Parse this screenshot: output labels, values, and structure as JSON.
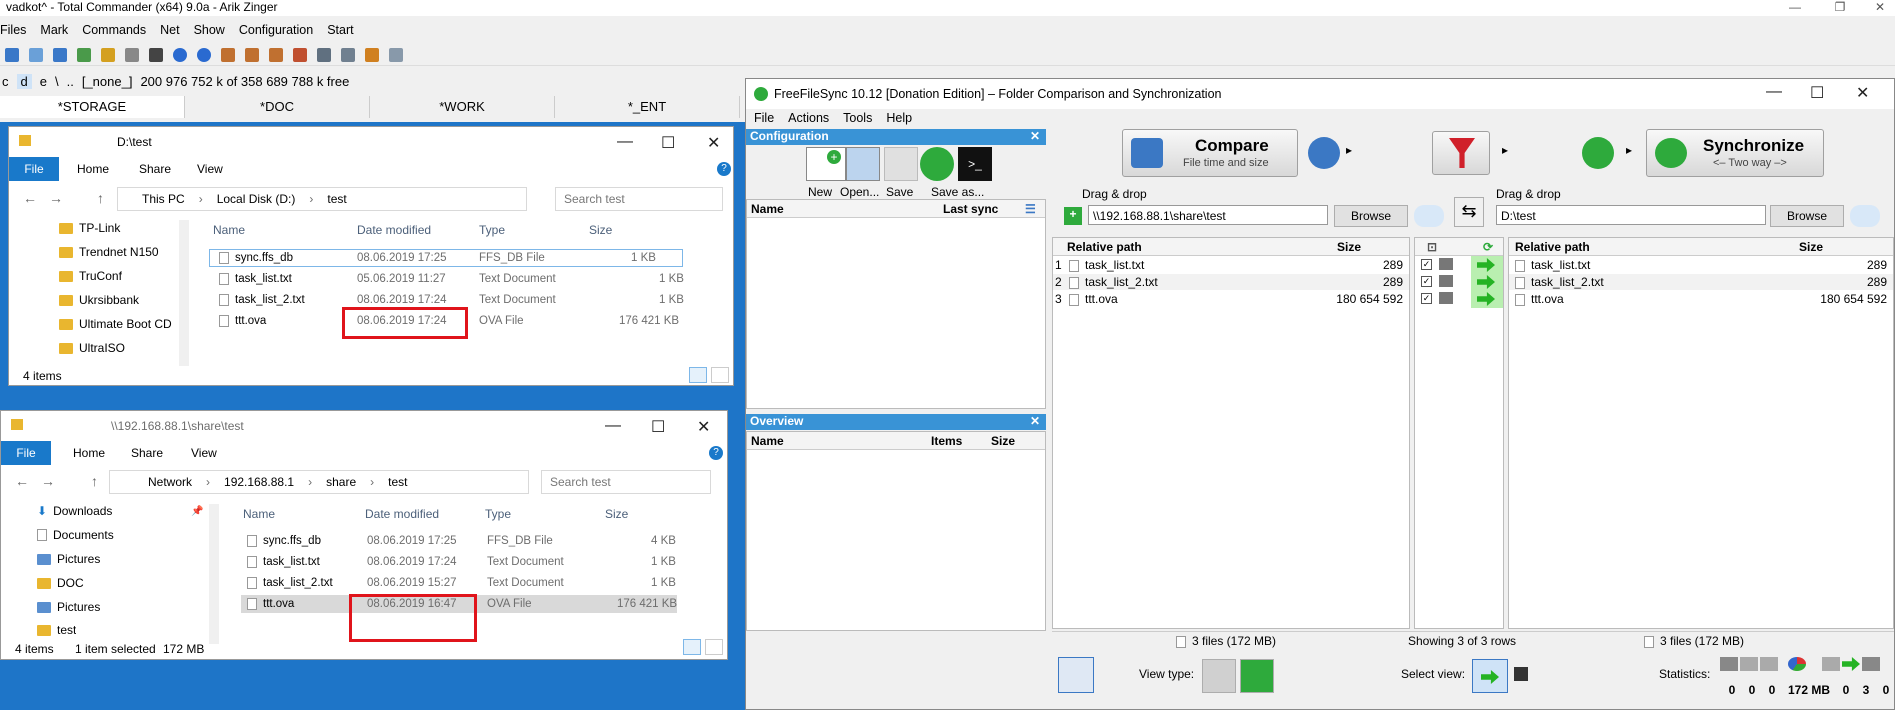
{
  "tc": {
    "title": "vadkot^ - Total Commander (x64) 9.0a - Arik Zinger",
    "menu": [
      "Files",
      "Mark",
      "Commands",
      "Net",
      "Show",
      "Configuration",
      "Start"
    ],
    "drive": {
      "letter_c": "c",
      "letter_d": "d",
      "letter_e": "e",
      "path_sep": "\\",
      "up": "..",
      "none": "[_none_]",
      "free": "200 976 752 k of 358 689 788 k free"
    },
    "tabs": [
      "*STORAGE",
      "*DOC",
      "*WORK",
      "*_ENT"
    ]
  },
  "explorer1": {
    "title": "D:\\test",
    "ribbon": {
      "file": "File",
      "home": "Home",
      "share": "Share",
      "view": "View"
    },
    "breadcrumb": [
      "This PC",
      "Local Disk (D:)",
      "test"
    ],
    "search_placeholder": "Search test",
    "tree": [
      "TP-Link",
      "Trendnet N150",
      "TruConf",
      "Ukrsibbank",
      "Ultimate Boot CD",
      "UltraISO"
    ],
    "columns": {
      "name": "Name",
      "date": "Date modified",
      "type": "Type",
      "size": "Size"
    },
    "files": [
      {
        "name": "sync.ffs_db",
        "date": "08.06.2019 17:25",
        "type": "FFS_DB File",
        "size": "1 KB"
      },
      {
        "name": "task_list.txt",
        "date": "05.06.2019 11:27",
        "type": "Text Document",
        "size": "1 KB"
      },
      {
        "name": "task_list_2.txt",
        "date": "08.06.2019 17:24",
        "type": "Text Document",
        "size": "1 KB"
      },
      {
        "name": "ttt.ova",
        "date": "08.06.2019 17:24",
        "type": "OVA File",
        "size": "176 421 KB"
      }
    ],
    "status": "4 items"
  },
  "explorer2": {
    "title": "\\\\192.168.88.1\\share\\test",
    "ribbon": {
      "file": "File",
      "home": "Home",
      "share": "Share",
      "view": "View"
    },
    "breadcrumb": [
      "Network",
      "192.168.88.1",
      "share",
      "test"
    ],
    "search_placeholder": "Search test",
    "tree": [
      "Downloads",
      "Documents",
      "Pictures",
      "DOC",
      "Pictures",
      "test"
    ],
    "columns": {
      "name": "Name",
      "date": "Date modified",
      "type": "Type",
      "size": "Size"
    },
    "files": [
      {
        "name": "sync.ffs_db",
        "date": "08.06.2019 17:25",
        "type": "FFS_DB File",
        "size": "4 KB"
      },
      {
        "name": "task_list.txt",
        "date": "08.06.2019 17:24",
        "type": "Text Document",
        "size": "1 KB"
      },
      {
        "name": "task_list_2.txt",
        "date": "08.06.2019 15:27",
        "type": "Text Document",
        "size": "1 KB"
      },
      {
        "name": "ttt.ova",
        "date": "08.06.2019 16:47",
        "type": "OVA File",
        "size": "176 421 KB"
      }
    ],
    "status": {
      "items": "4 items",
      "selected": "1 item selected",
      "size": "172 MB"
    }
  },
  "ffs": {
    "title": "FreeFileSync 10.12 [Donation Edition] – Folder Comparison and Synchronization",
    "menu": [
      "File",
      "Actions",
      "Tools",
      "Help"
    ],
    "config": {
      "header": "Configuration",
      "new": "New",
      "open": "Open...",
      "save": "Save",
      "save_as": "Save as...",
      "col_name": "Name",
      "col_last_sync": "Last sync"
    },
    "overview": {
      "header": "Overview",
      "col_name": "Name",
      "col_items": "Items",
      "col_size": "Size"
    },
    "compare": {
      "label": "Compare",
      "sub": "File time and size"
    },
    "synchronize": {
      "label": "Synchronize",
      "sub": "<– Two way –>"
    },
    "left": {
      "drag": "Drag & drop",
      "path": "\\\\192.168.88.1\\share\\test",
      "browse": "Browse"
    },
    "right": {
      "drag": "Drag & drop",
      "path": "D:\\test",
      "browse": "Browse"
    },
    "grid": {
      "col_path": "Relative path",
      "col_size": "Size"
    },
    "rows": [
      {
        "n": "1",
        "left": "task_list.txt",
        "lsize": "289",
        "right": "task_list.txt",
        "rsize": "289"
      },
      {
        "n": "2",
        "left": "task_list_2.txt",
        "lsize": "289",
        "right": "task_list_2.txt",
        "rsize": "289"
      },
      {
        "n": "3",
        "left": "ttt.ova",
        "lsize": "180 654 592",
        "right": "ttt.ova",
        "rsize": "180 654 592"
      }
    ],
    "status": {
      "left": "3 files (172 MB)",
      "middle": "Showing 3 of 3 rows",
      "right": "3 files (172 MB)"
    },
    "bottom": {
      "view_type": "View type:",
      "select_view": "Select view:",
      "statistics": "Statistics:",
      "stats": [
        "0",
        "0",
        "0",
        "172 MB",
        "0",
        "3",
        "0"
      ]
    }
  }
}
